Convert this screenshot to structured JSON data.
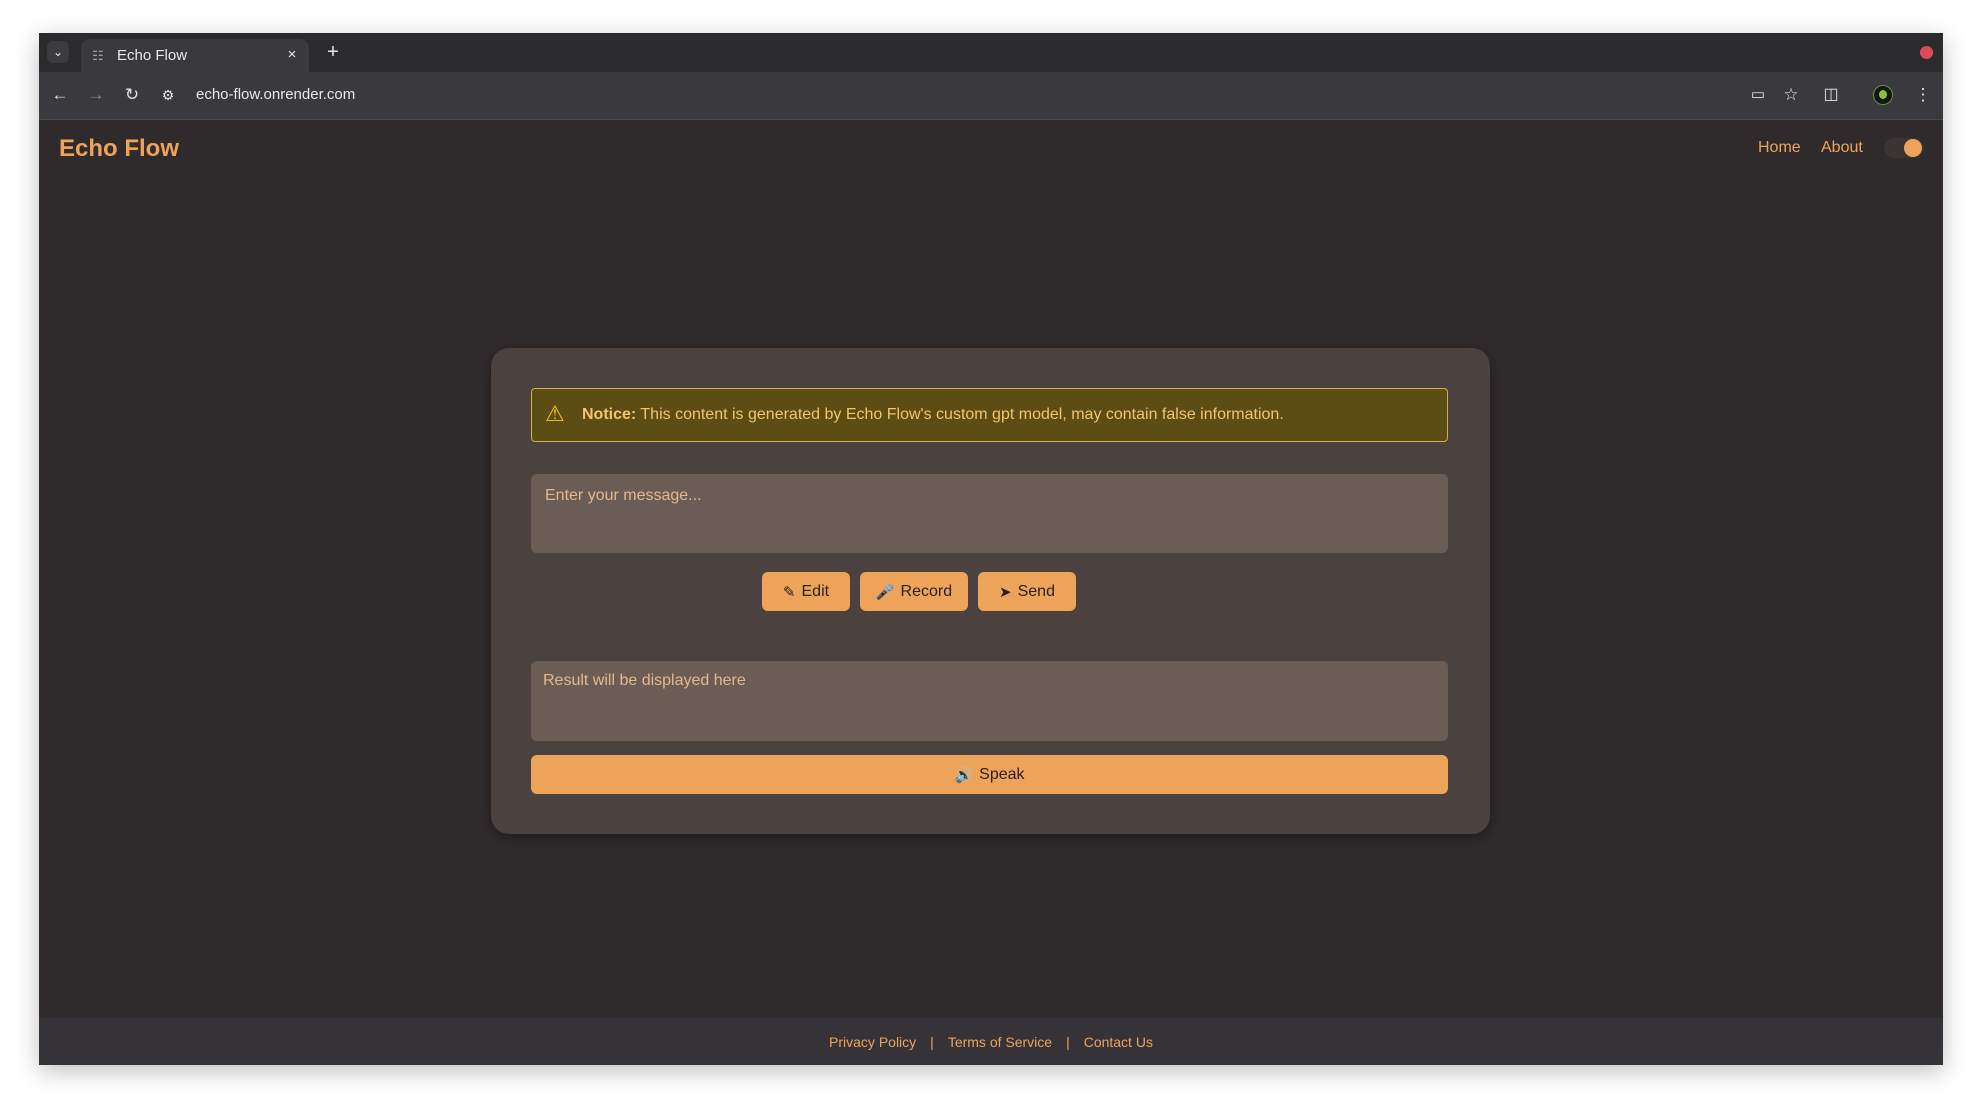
{
  "browser": {
    "tab_title": "Echo Flow",
    "url": "echo-flow.onrender.com",
    "tab_list_icon": "chevron-down-icon",
    "new_tab_icon": "plus-icon",
    "close_icon": "close-icon"
  },
  "header": {
    "brand": "Echo Flow",
    "nav": [
      {
        "label": "Home"
      },
      {
        "label": "About"
      }
    ],
    "theme_toggle_on": true
  },
  "notice": {
    "label": "Notice:",
    "text": " This content is generated by Echo Flow's custom gpt model, may contain false information."
  },
  "message": {
    "placeholder": "Enter your message...",
    "value": ""
  },
  "actions": {
    "edit_label": "Edit",
    "record_label": "Record",
    "send_label": "Send"
  },
  "result": {
    "text": "Result will be displayed here"
  },
  "speak": {
    "label": "Speak"
  },
  "footer": {
    "links": [
      "Privacy Policy",
      "Terms of Service",
      "Contact Us"
    ],
    "separator": "|"
  },
  "colors": {
    "accent": "#eea35a",
    "background": "#2f2b2c",
    "card": "#4b413e",
    "notice_bg": "#5b4d14",
    "notice_border": "#d2b040"
  }
}
